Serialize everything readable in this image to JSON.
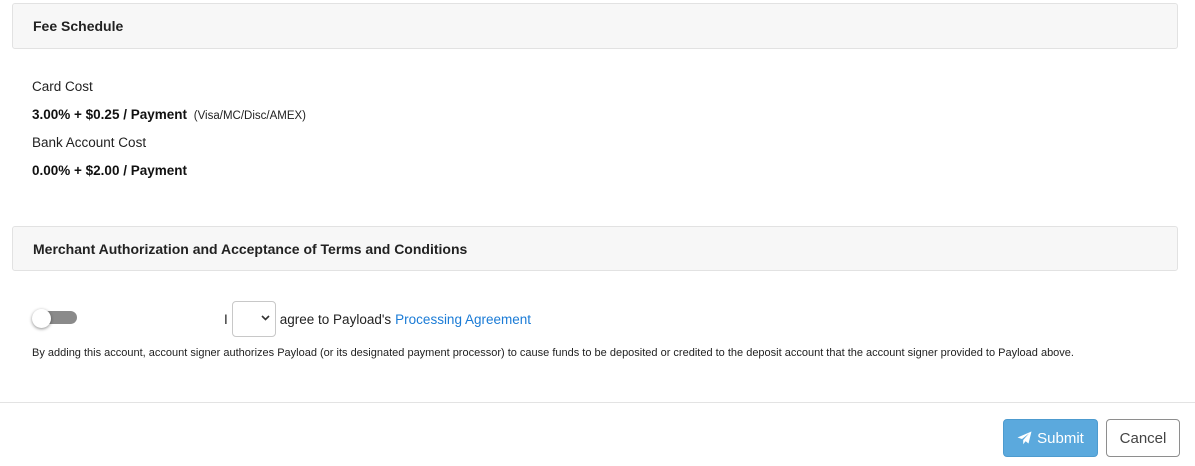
{
  "fee_schedule": {
    "title": "Fee Schedule",
    "card_cost_label": "Card Cost",
    "card_cost_value": "3.00% + $0.25 / Payment",
    "card_cost_note": "(Visa/MC/Disc/AMEX)",
    "bank_cost_label": "Bank Account Cost",
    "bank_cost_value": "0.00% + $2.00 / Payment"
  },
  "terms": {
    "title": "Merchant Authorization and Acceptance of Terms and Conditions",
    "toggle_on": false,
    "agree_prefix": "I",
    "agree_select_value": "",
    "agree_text": "agree to Payload's",
    "agree_link": "Processing Agreement",
    "disclaimer": "By adding this account, account signer authorizes Payload (or its designated payment processor) to cause funds to be deposited or credited to the deposit account that the account signer provided to Payload above."
  },
  "actions": {
    "submit_label": "Submit",
    "submit_icon": "paper-plane-icon",
    "cancel_label": "Cancel"
  },
  "colors": {
    "submit_bg": "#5ba9dd",
    "link": "#1a7bd6",
    "toggle_track": "#8a8a8a"
  }
}
